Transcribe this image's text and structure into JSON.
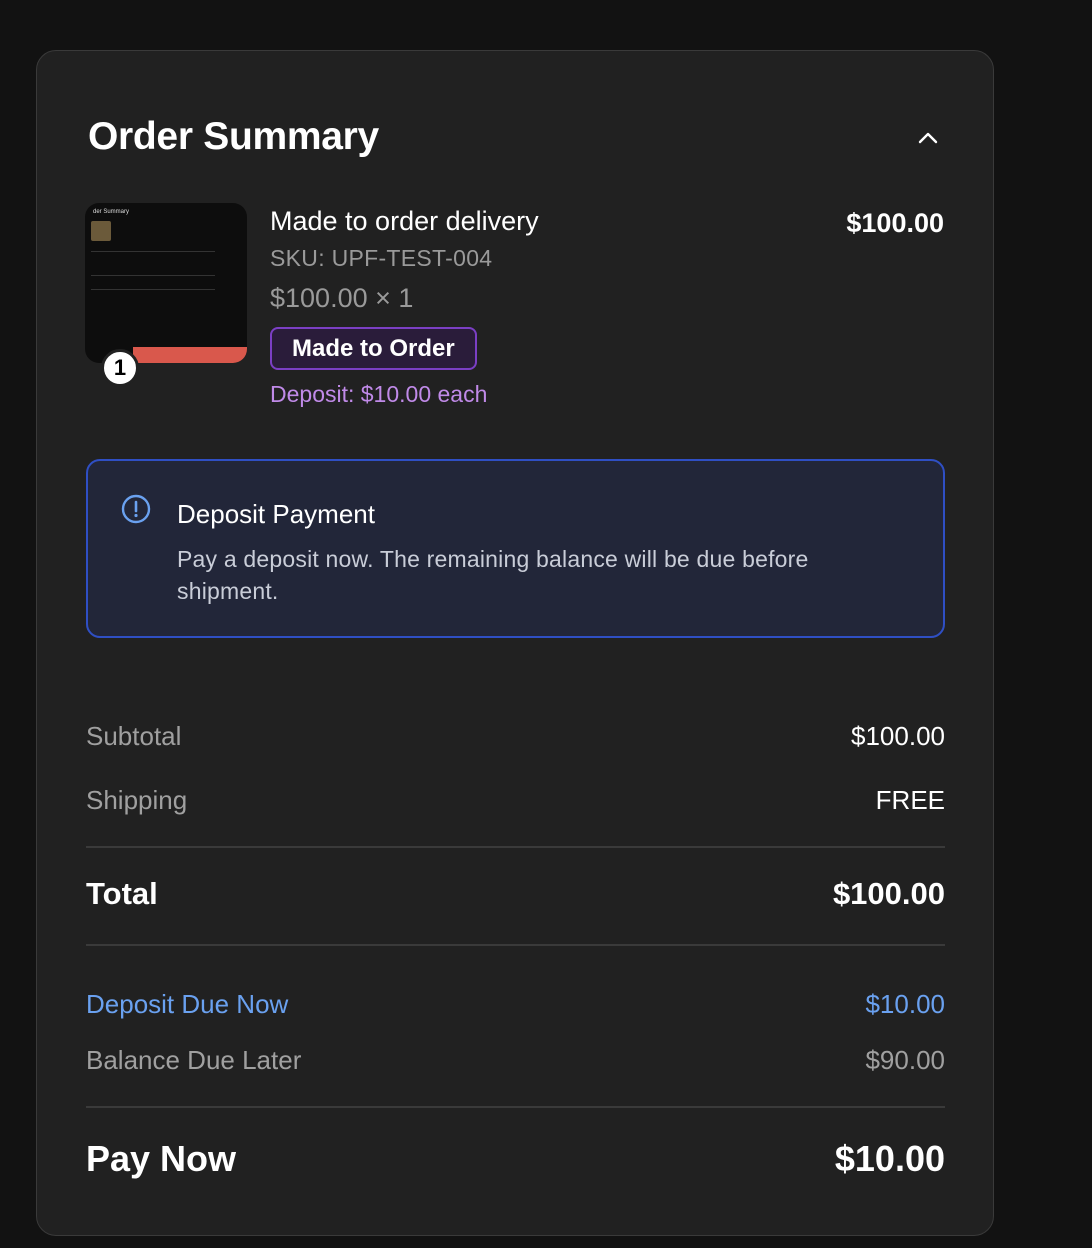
{
  "summary": {
    "title": "Order Summary",
    "collapse_icon": "chevron-up-icon"
  },
  "item": {
    "name": "Made to order delivery",
    "price": "$100.00",
    "sku": "SKU: UPF-TEST-004",
    "unit_line": "$100.00 × 1",
    "quantity": "1",
    "badge": "Made to Order",
    "deposit_each": "Deposit: $10.00 each",
    "thumbnail": {
      "title": "der Summary"
    }
  },
  "notice": {
    "icon": "info-circle-icon",
    "title": "Deposit Payment",
    "text": "Pay a deposit now. The remaining balance will be due before shipment."
  },
  "totals": {
    "subtotal_label": "Subtotal",
    "subtotal_value": "$100.00",
    "shipping_label": "Shipping",
    "shipping_value": "FREE",
    "total_label": "Total",
    "total_value": "$100.00",
    "deposit_label": "Deposit Due Now",
    "deposit_value": "$10.00",
    "balance_label": "Balance Due Later",
    "balance_value": "$90.00",
    "pay_label": "Pay Now",
    "pay_value": "$10.00"
  },
  "colors": {
    "background": "#121212",
    "card": "#212121",
    "accent_blue": "#6aa1f0",
    "accent_purple": "#c08ae8",
    "badge_border": "#7b3fc4",
    "notice_border": "#2f4fc4"
  }
}
